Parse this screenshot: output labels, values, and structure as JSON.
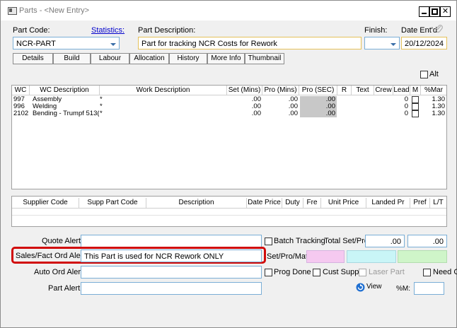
{
  "window": {
    "title": "Parts - <New Entry>",
    "min": "",
    "max": "",
    "close": "✕"
  },
  "header": {
    "part_code_label": "Part Code:",
    "statistics_link": "Statistics:",
    "part_description_label": "Part Description:",
    "finish_label": "Finish:",
    "date_label": "Date Ent'd:",
    "part_code_value": "NCR-PART",
    "part_description_value": "Part for tracking NCR Costs for Rework",
    "finish_value": "",
    "date_value": "20/12/2024"
  },
  "tabs": [
    "Details",
    "Build",
    "Labour",
    "Allocation",
    "History",
    "More Info",
    "Thumbnail"
  ],
  "alt_label": "Alt",
  "operations": {
    "columns": [
      "WC",
      "WC Description",
      "Work Description",
      "Set (Mins)",
      "Pro (Mins)",
      "Pro (SEC)",
      "R",
      "Text",
      "Crew",
      "Lead",
      "M",
      "%Mar"
    ],
    "rows": [
      {
        "wc": "997",
        "wc_desc": "Assembly",
        "work_desc": "*",
        "set": ".00",
        "pro": ".00",
        "pro_sec": ".00",
        "lead": "0",
        "mar": "1.30"
      },
      {
        "wc": "996",
        "wc_desc": "Welding",
        "work_desc": "*",
        "set": ".00",
        "pro": ".00",
        "pro_sec": ".00",
        "lead": "0",
        "mar": "1.30"
      },
      {
        "wc": "2102",
        "wc_desc": "Bending - Trumpf 513(",
        "work_desc": "*",
        "set": ".00",
        "pro": ".00",
        "pro_sec": ".00",
        "lead": "0",
        "mar": "1.30"
      }
    ]
  },
  "suppliers": {
    "columns": [
      "Supplier Code",
      "Supp Part Code",
      "Description",
      "Date Price",
      "Duty",
      "Fre",
      "Unit Price",
      "Landed Pr",
      "Pref",
      "L/T"
    ]
  },
  "alerts": {
    "quote_label": "Quote Alert:",
    "sales_label": "Sales/Fact Ord Alert:",
    "auto_label": "Auto Ord Alert:",
    "part_label": "Part Alert:",
    "quote_value": "",
    "sales_value": "This Part is used for NCR Rework ONLY",
    "auto_value": "",
    "part_value": ""
  },
  "options": {
    "batch_tracking": "Batch Tracking",
    "total_set_pro": "Total Set/Pro",
    "total_value_1": ".00",
    "total_value_2": ".00",
    "set_pro_mat": "Set/Pro/Mat",
    "prog_done": "Prog Done",
    "cust_supp": "Cust Supp",
    "laser_part": "Laser Part",
    "need_cert": "Need Cert",
    "view": "View",
    "pct_m": "%M:"
  },
  "colors": {
    "pink": "#f5c9f0",
    "cyan": "#c9f5f7",
    "green": "#cff5c9",
    "highlight": "#d10a0a",
    "field_border": "#7aaed6"
  }
}
